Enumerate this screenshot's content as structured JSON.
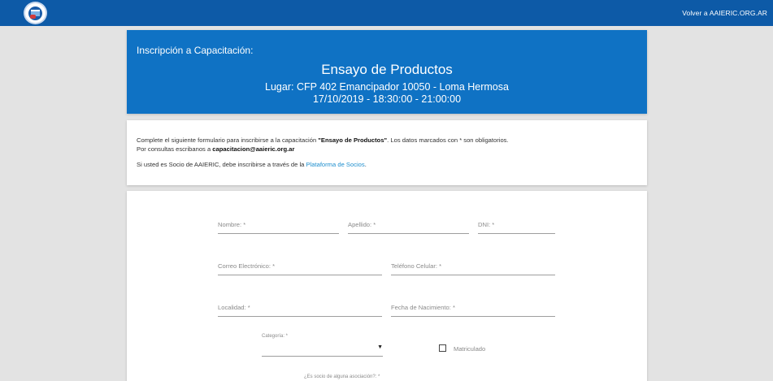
{
  "topbar": {
    "back_link": "Volver a AAIERIC.ORG.AR",
    "logo_text": "AAIERIC"
  },
  "header": {
    "kicker": "Inscripción a Capacitación:",
    "title": "Ensayo de Productos",
    "place": "Lugar: CFP 402 Emancipador 10050 - Loma Hermosa",
    "date": "17/10/2019 - 18:30:00 - 21:00:00"
  },
  "info": {
    "line1_pre": "Complete el siguiente formulario para inscribirse a la capacitación ",
    "line1_course": "\"Ensayo de Productos\"",
    "line1_post": ". Los datos marcados con * son obligatorios.",
    "line2_pre": "Por consultas escribanos a ",
    "line2_email": "capacitacion@aaieric.org.ar",
    "line3_pre": "Si usted es Socio de AAIERIC, debe inscribirse a través de la ",
    "line3_link": "Plataforma de Socios",
    "line3_post": "."
  },
  "form": {
    "nombre": "Nombre: *",
    "apellido": "Apellido: *",
    "dni": "DNI: *",
    "correo": "Correo Electrónico: *",
    "telefono": "Teléfono Celular: *",
    "localidad": "Localidad: *",
    "nacimiento": "Fecha de Nacimiento: *",
    "categoria": "Categoría: *",
    "categoria_arrow": "▼",
    "matriculado": "Matriculado",
    "asociacion": "¿Es socio de alguna asociación?: *"
  },
  "colors": {
    "topbar": "#0d5aa7",
    "header": "#0f72c4",
    "link": "#1f8fce",
    "background": "#e3e3e3"
  }
}
